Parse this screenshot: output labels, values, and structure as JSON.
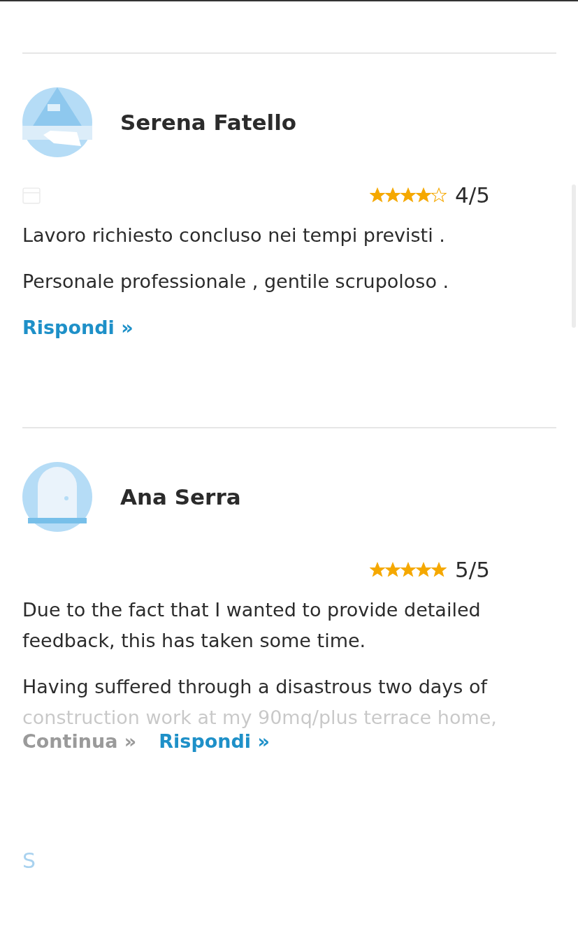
{
  "reviews": [
    {
      "name": "Serena Fatello",
      "avatar": {
        "kind": "picture"
      },
      "date_icon": true,
      "stars": 4,
      "rating": "4/5",
      "paragraphs": [
        "Lavoro richiesto concluso nei tempi previsti .",
        "Personale professionale , gentile scrupoloso ."
      ],
      "truncated": false,
      "links": [
        {
          "label": "Rispondi »",
          "kind": "reply"
        }
      ]
    },
    {
      "name": "Ana Serra",
      "avatar": {
        "kind": "picture"
      },
      "date_icon": false,
      "stars": 5,
      "rating": "5/5",
      "paragraphs": [
        "Due to the fact that I wanted to provide detailed feedback, this has taken some time.",
        "Having suffered through a disastrous two days of construction work at my 90mq/plus terrace home,"
      ],
      "truncated": true,
      "links": [
        {
          "label": "Continua »",
          "kind": "more"
        },
        {
          "label": "Rispondi »",
          "kind": "reply"
        }
      ]
    }
  ],
  "next_initial": "S"
}
